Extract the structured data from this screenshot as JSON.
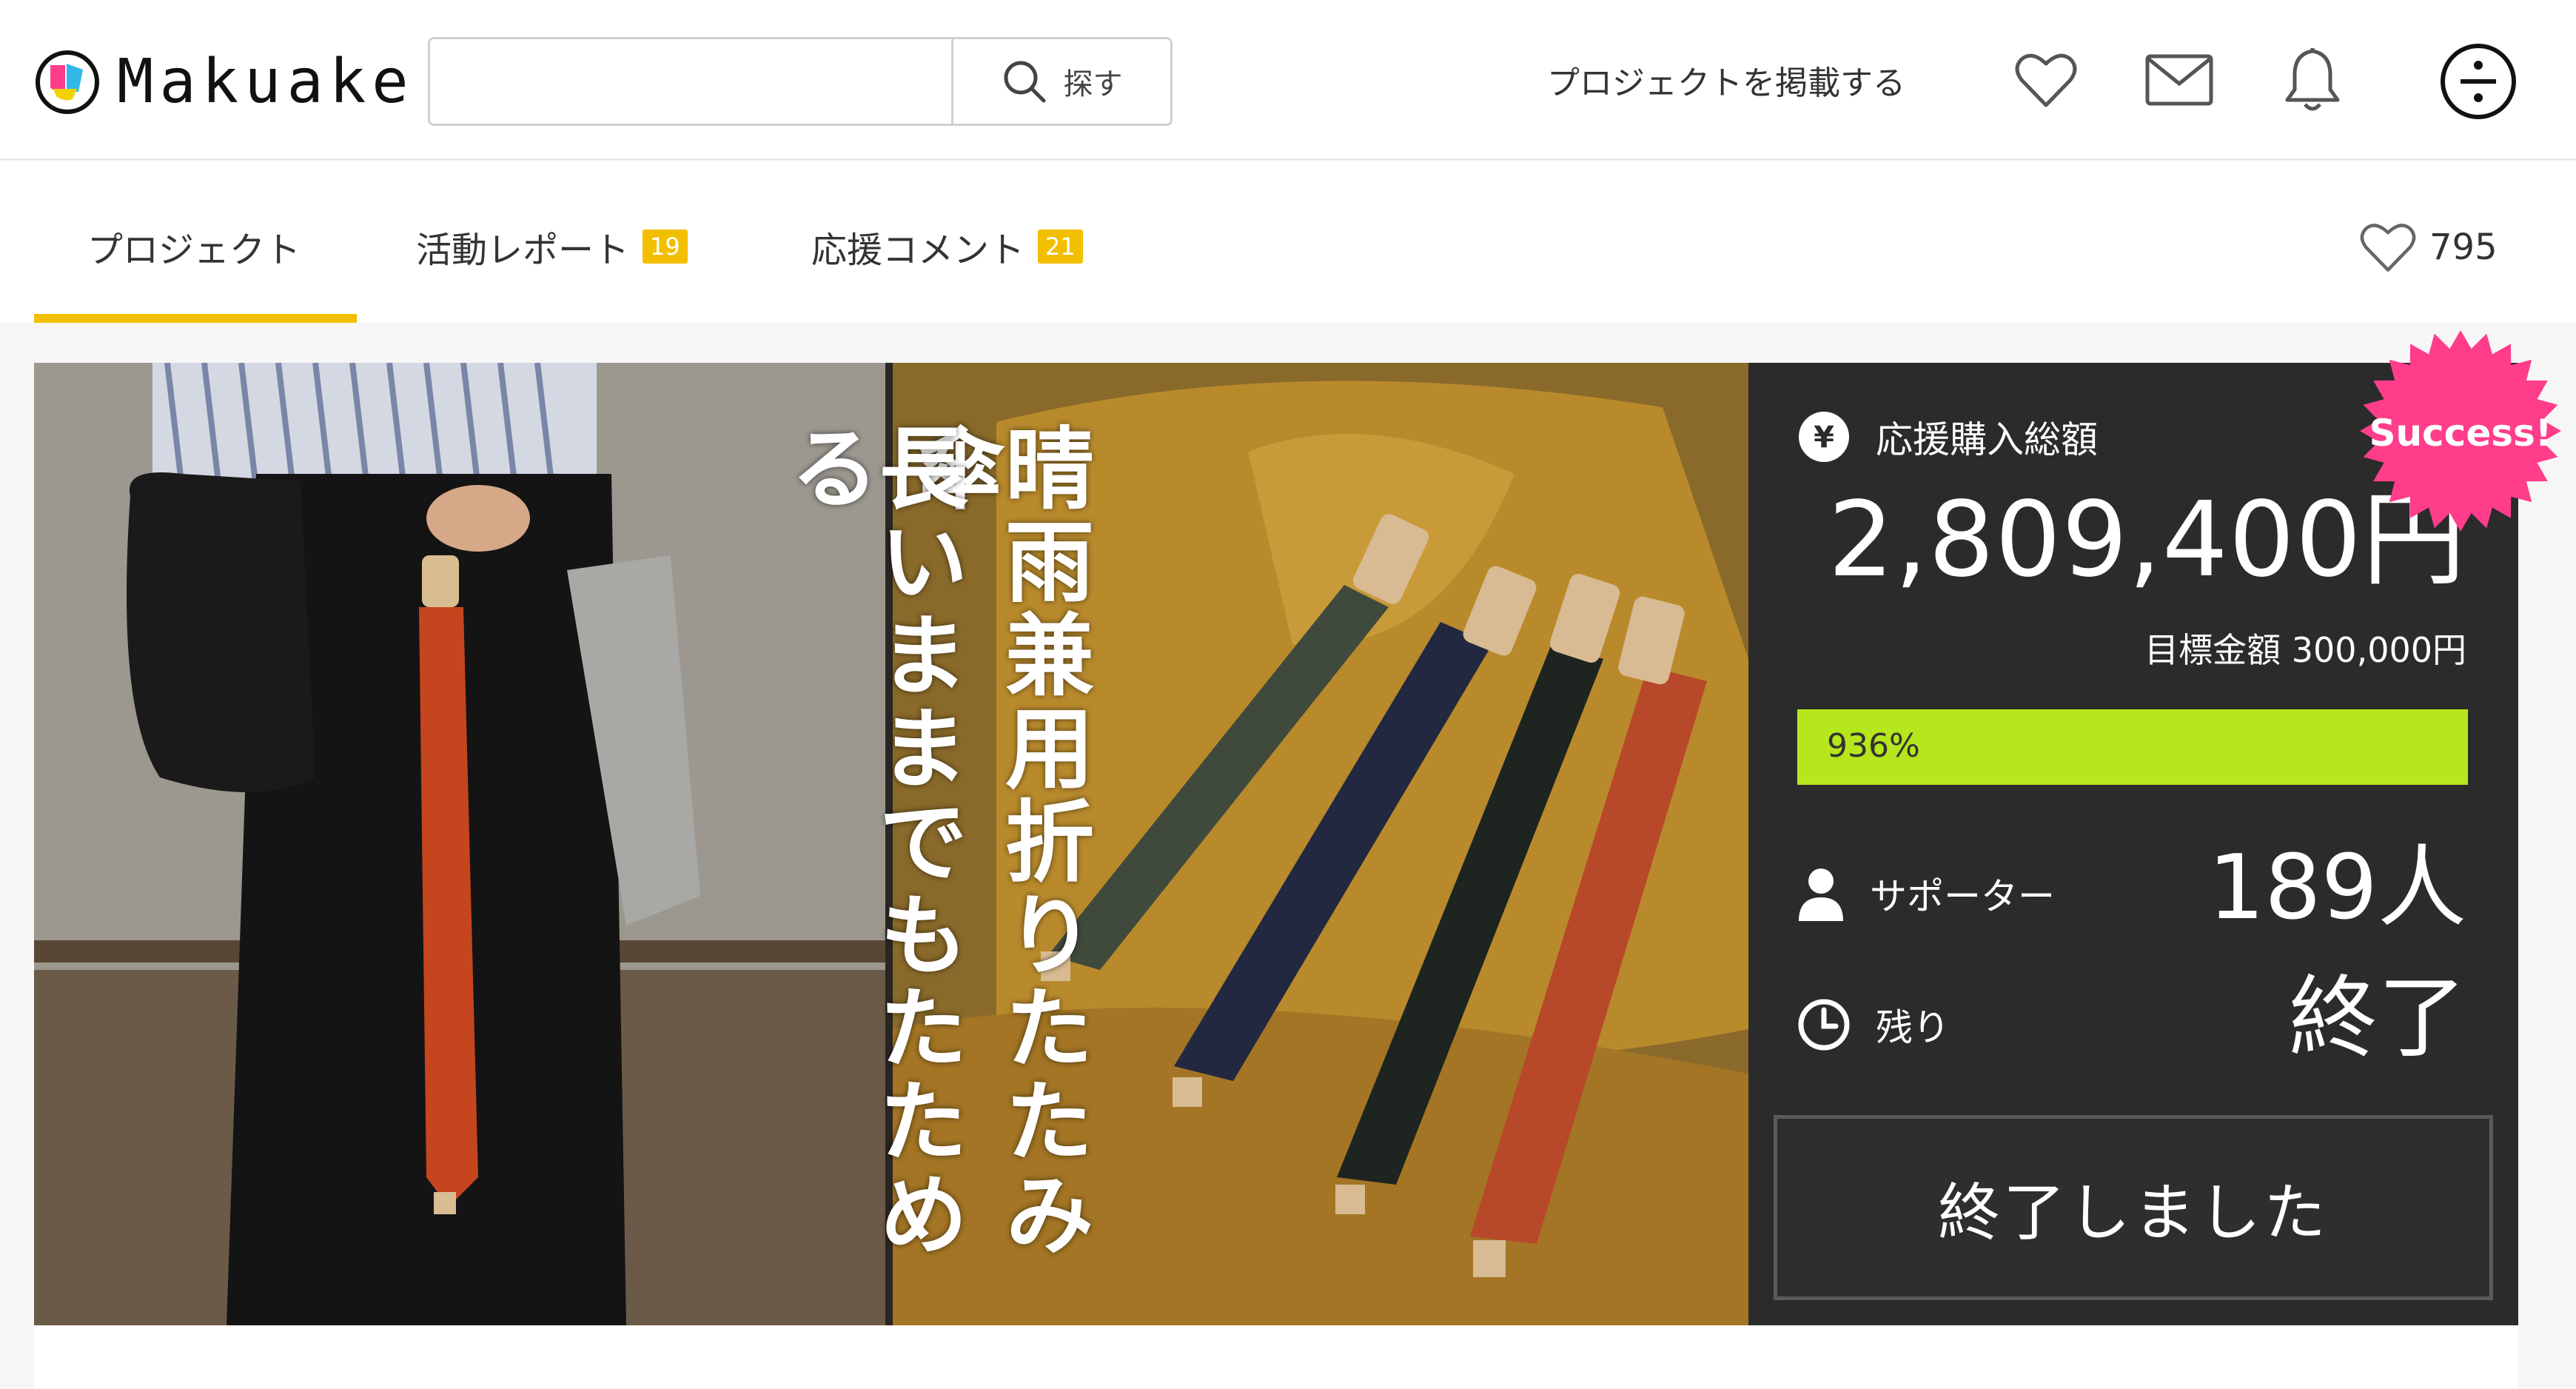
{
  "colors": {
    "accent_yellow": "#f2bf00",
    "progress_green": "#b6e61c",
    "panel_bg": "#2b2b2b",
    "success_pink": "#ff3d8b"
  },
  "header": {
    "logo_text": "Makuake",
    "search": {
      "placeholder": "",
      "button_label": "探す",
      "icon": "search-icon"
    },
    "post_project_label": "プロジェクトを掲載する",
    "icons": [
      "heart-icon",
      "mail-icon",
      "bell-icon",
      "menu-icon"
    ]
  },
  "tabs": [
    {
      "label": "プロジェクト",
      "badge": "",
      "active": true
    },
    {
      "label": "活動レポート",
      "badge": "19"
    },
    {
      "label": "応援コメント",
      "badge": "21"
    }
  ],
  "likes": {
    "count": "795",
    "icon": "heart-icon"
  },
  "hero": {
    "headline_right": "晴雨兼用折りたたみ傘",
    "headline_left": "長いままでもたためる"
  },
  "funding": {
    "total_label": "応援購入総額",
    "total_amount": "2,809,400円",
    "goal_text": "目標金額 300,000円",
    "progress_percent_label": "936%",
    "progress_fraction": 1.0,
    "supporters_label": "サポーター",
    "supporters_value": "189人",
    "remaining_label": "残り",
    "remaining_value": "終了",
    "ended_button_label": "終了しました",
    "success_badge": "Success!"
  }
}
